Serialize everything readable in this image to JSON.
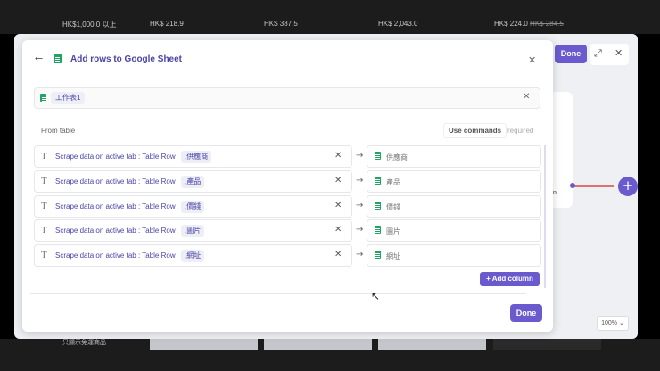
{
  "background": {
    "prices": [
      {
        "text": "HK$1,000.0 以上",
        "strike": ""
      },
      {
        "text": "HK$ 218.9",
        "strike": ""
      },
      {
        "text": "HK$ 387.5",
        "strike": ""
      },
      {
        "text": "HK$ 2,043.0",
        "strike": ""
      },
      {
        "text": "HK$ 224.0",
        "strike": "HK$ 284.5"
      }
    ],
    "bottom_text": "只顯示免運商品"
  },
  "window": {
    "done_label": "Done",
    "zoom": "100%",
    "canvas_card_text": "n"
  },
  "dialog": {
    "title": "Add rows to Google Sheet",
    "sheet_name": "工作表1",
    "from_label": "From table",
    "use_commands_label": "Use commands",
    "required_label": "required",
    "add_column_label": "Add column",
    "done_label": "Done",
    "mappings": [
      {
        "source": "Scrape data on active tab : Table Row",
        "tag": ",供應商",
        "target": "供應商"
      },
      {
        "source": "Scrape data on active tab : Table Row",
        "tag": ",產品",
        "target": "產品"
      },
      {
        "source": "Scrape data on active tab : Table Row",
        "tag": ",價錢",
        "target": "價錢"
      },
      {
        "source": "Scrape data on active tab : Table Row",
        "tag": ",圖片",
        "target": "圖片"
      },
      {
        "source": "Scrape data on active tab : Table Row",
        "tag": ",網址",
        "target": "網址"
      }
    ]
  },
  "icons": {
    "back": "arrow-left-icon",
    "close": "close-icon",
    "expand": "expand-icon",
    "sheet": "google-sheet-icon",
    "text": "text-type-icon",
    "mapping_arrow": "arrow-right-icon",
    "plus": "plus-icon",
    "chevron": "chevron-down-icon"
  },
  "colors": {
    "accent": "#6a5acd",
    "title": "#4a44a8",
    "sheet_green": "#1fa463",
    "connector": "#e07070"
  }
}
